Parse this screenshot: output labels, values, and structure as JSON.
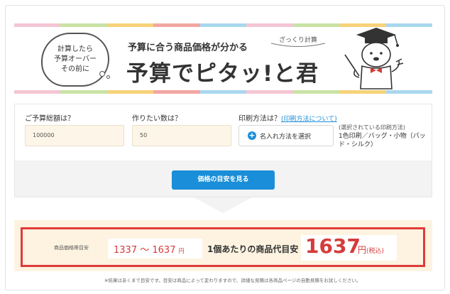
{
  "banner": {
    "bubble_lines": [
      "計算したら",
      "予算オーバー",
      "その前に"
    ],
    "subtitle": "予算に合う商品価格が分かる",
    "badge": "ざっくり計算",
    "title": "予算でピタッ!と君",
    "stripe_colors": [
      "#f4c6d3",
      "#c9e3a5",
      "#f7d27a",
      "#f2a7a2",
      "#a9d7ee",
      "#f4c6d3",
      "#c9e3a5",
      "#f7d27a",
      "#a9d7ee"
    ]
  },
  "form": {
    "budget_label": "ご予算総額は？",
    "budget_value": "100000",
    "qty_label": "作りたい数は？",
    "qty_value": "50",
    "print_label": "印刷方法は？",
    "print_link": "(印刷方法について)",
    "select_button": "名入れ方法を選択",
    "selected_caption": "(選択されている印刷方法)",
    "selected_method": "1色印刷／バッグ・小物（パッド・シルク）"
  },
  "action": {
    "show_button": "価格の目安を見る"
  },
  "result": {
    "price_band_label": "商品価格帯目安",
    "range_min": "1337",
    "range_sep": "〜",
    "range_max": "1637",
    "range_unit": "円",
    "per_item_label": "1個あたりの商品代目安",
    "per_item_value": "1637",
    "per_item_unit": "円",
    "tax_note": "(税込)"
  },
  "footer": {
    "note": "※結果はあくまで目安です。目安は商品によって変わりますので、詳細な見積は各商品ページの自動見積をお試しください。"
  },
  "colors": {
    "accent": "#1a8ed8",
    "highlight": "#e03a3a",
    "result_bg": "#fdf3e0"
  }
}
